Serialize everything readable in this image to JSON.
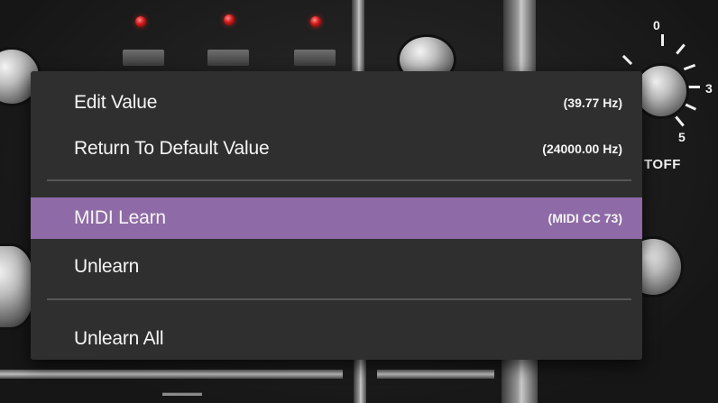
{
  "colors": {
    "menu_background": "#2f2f2f",
    "highlight": "#8e6aa6",
    "text": "#f5f5f5",
    "separator": "#575757",
    "led": "#d01818"
  },
  "background_panel": {
    "dial_scale": [
      "0",
      "3",
      "5"
    ],
    "dial_label": "TOFF"
  },
  "context_menu": {
    "items": [
      {
        "label": "Edit Value",
        "value": "(39.77 Hz)",
        "highlighted": false
      },
      {
        "label": "Return To Default Value",
        "value": "(24000.00 Hz)",
        "highlighted": false
      },
      {
        "label": "MIDI Learn",
        "value": "(MIDI CC 73)",
        "highlighted": true
      },
      {
        "label": "Unlearn",
        "value": "",
        "highlighted": false
      },
      {
        "label": "Unlearn All",
        "value": "",
        "highlighted": false
      }
    ]
  }
}
